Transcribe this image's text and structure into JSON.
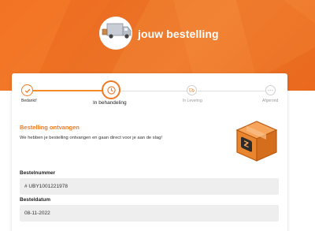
{
  "header": {
    "title": "jouw bestelling",
    "illustration": "delivery-truck-icon"
  },
  "stepper": {
    "steps": [
      {
        "label": "Bedankt!",
        "state": "done",
        "icon": "check-icon"
      },
      {
        "label": "In behandeling",
        "state": "active",
        "icon": "clock-icon"
      },
      {
        "label": "In Levering",
        "state": "pending",
        "icon": "truck-icon"
      },
      {
        "label": "Afgerond",
        "state": "pending",
        "icon": "dots-icon"
      }
    ]
  },
  "order": {
    "status_title": "Bestelling ontvangen",
    "status_text": "We hebben je bestelling ontvangen en gaan direct voor je aan de slag!",
    "illustration": "package-box-icon",
    "order_number_label": "Bestelnummer",
    "order_number_value": "# UBY1001221978",
    "order_date_label": "Besteldatum",
    "order_date_value": "08-11-2022"
  },
  "colors": {
    "brand_orange": "#f07a23",
    "hero_orange": "#f26b1d",
    "field_bg": "#eeeeee"
  }
}
